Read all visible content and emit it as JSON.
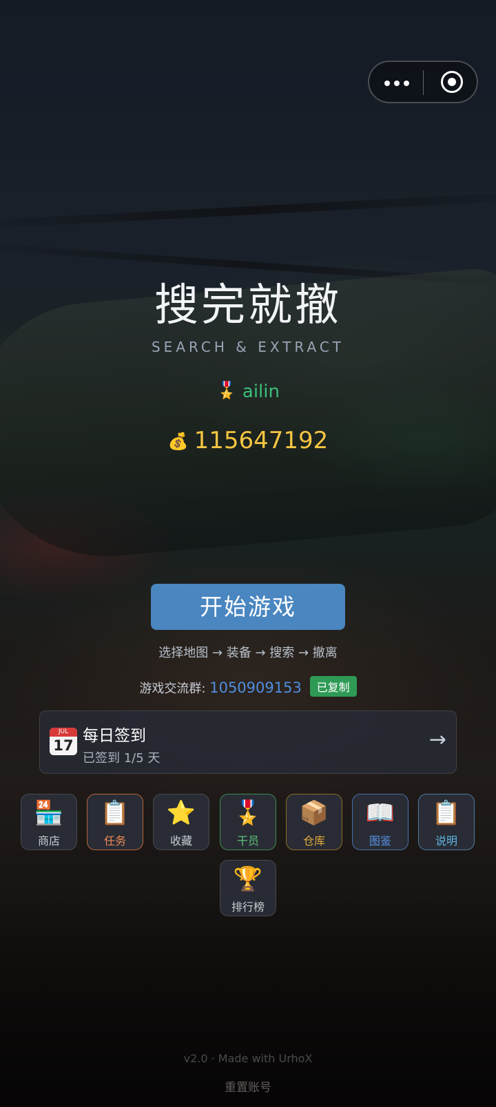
{
  "title": "搜完就撤",
  "subtitle": "SEARCH & EXTRACT",
  "player": {
    "name_icon": "🎖️",
    "name": "ailin",
    "coins_icon": "💰",
    "coins": "115647192"
  },
  "start_button": "开始游戏",
  "flow_text": "选择地图 → 装备 → 搜索 → 撤离",
  "group": {
    "label": "游戏交流群:",
    "number": "1050909153",
    "badge": "已复制"
  },
  "daily": {
    "icon_month": "JUL",
    "icon_day": "17",
    "title": "每日签到",
    "status": "已签到 1/5 天",
    "arrow": "→"
  },
  "menu": [
    {
      "icon": "🏪",
      "label": "商店"
    },
    {
      "icon": "📋",
      "label": "任务"
    },
    {
      "icon": "⭐",
      "label": "收藏"
    },
    {
      "icon": "🎖️",
      "label": "干员"
    },
    {
      "icon": "📦",
      "label": "仓库"
    },
    {
      "icon": "📖",
      "label": "图鉴"
    },
    {
      "icon": "📋",
      "label": "说明"
    },
    {
      "icon": "🏆",
      "label": "排行榜"
    }
  ],
  "footer": {
    "version": "v2.0 · Made with UrhoX",
    "reset": "重置账号"
  }
}
